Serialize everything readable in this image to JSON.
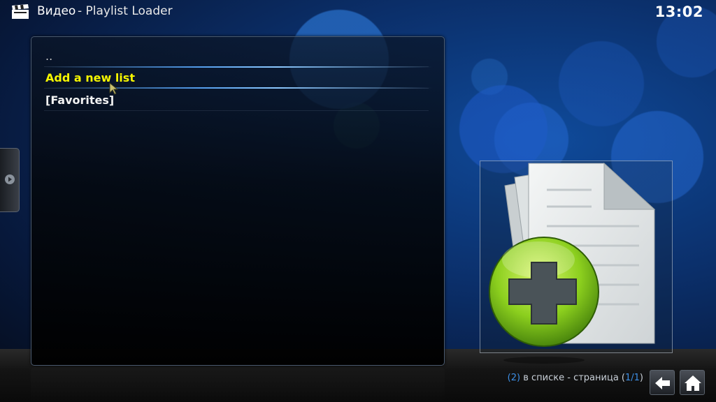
{
  "header": {
    "section_title": "Видео",
    "addon_title": "- Playlist Loader",
    "clock": "13:02",
    "section_icon": "clapperboard-icon"
  },
  "list": {
    "items": [
      {
        "label": ".."
      },
      {
        "label": "Add a new list",
        "selected": true
      },
      {
        "label": "[Favorites]"
      }
    ]
  },
  "thumbnail": {
    "icon": "add-document-icon"
  },
  "status": {
    "count": "2",
    "in_list_text": " в списке - страница (",
    "page": "1/1",
    "close_paren": ")"
  },
  "buttons": {
    "back_icon": "back-arrow-icon",
    "home_icon": "home-icon"
  },
  "colors": {
    "selected_text": "#f5f500",
    "accent_blue": "#3d8fe6",
    "background_blue": "#0b2f6a"
  }
}
